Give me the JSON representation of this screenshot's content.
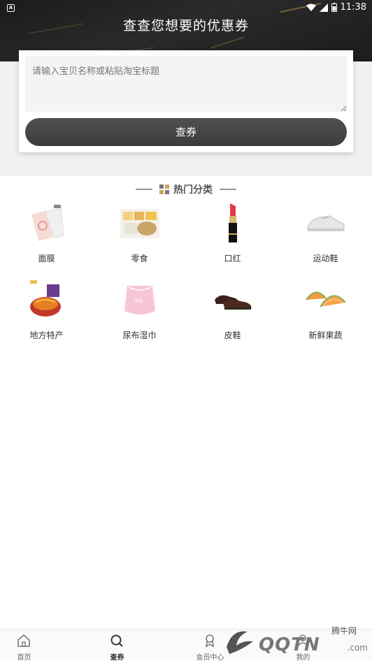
{
  "status_bar": {
    "time": "11:38"
  },
  "header": {
    "title": "查查您想要的优惠券"
  },
  "search": {
    "placeholder": "请输入宝贝名称或粘贴淘宝标题",
    "button_label": "查券"
  },
  "section": {
    "title": "热门分类"
  },
  "categories": [
    {
      "label": "面膜",
      "icon": "face-mask-icon"
    },
    {
      "label": "零食",
      "icon": "snacks-icon"
    },
    {
      "label": "口红",
      "icon": "lipstick-icon"
    },
    {
      "label": "运动鞋",
      "icon": "sneaker-icon"
    },
    {
      "label": "地方特产",
      "icon": "local-specialty-icon"
    },
    {
      "label": "尿布湿巾",
      "icon": "diaper-icon"
    },
    {
      "label": "皮鞋",
      "icon": "leather-shoe-icon"
    },
    {
      "label": "新鲜果蔬",
      "icon": "melon-icon"
    }
  ],
  "tabs": [
    {
      "label": "首页",
      "icon": "home-icon"
    },
    {
      "label": "查券",
      "icon": "search-icon"
    },
    {
      "label": "会员中心",
      "icon": "member-icon"
    },
    {
      "label": "我的",
      "icon": "profile-icon"
    }
  ],
  "watermark": {
    "text_top": "腾牛网",
    "text_main": "QQTN",
    "text_suffix": ".com"
  }
}
